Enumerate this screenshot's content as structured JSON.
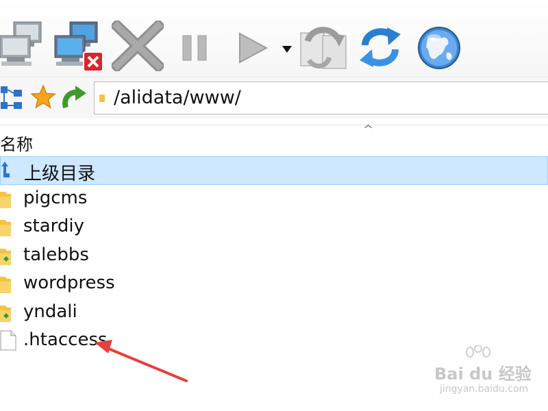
{
  "toolbar": {
    "buttons": [
      {
        "name": "connect",
        "icon": "computers-connect-icon"
      },
      {
        "name": "disconnect",
        "icon": "computers-disconnect-icon"
      },
      {
        "name": "cancel",
        "icon": "close-x-icon"
      },
      {
        "name": "pause",
        "icon": "pause-icon"
      },
      {
        "name": "play",
        "icon": "play-icon"
      },
      {
        "name": "play-menu",
        "icon": "dropdown-triangle-icon"
      },
      {
        "name": "sync",
        "icon": "sync-arrows-icon"
      },
      {
        "name": "refresh",
        "icon": "refresh-arrows-icon"
      },
      {
        "name": "web",
        "icon": "globe-icon"
      }
    ]
  },
  "address_bar": {
    "path": "/alidata/www/"
  },
  "columns": {
    "name_header": "名称"
  },
  "files": [
    {
      "label": "上级目录",
      "type": "parent",
      "selected": true
    },
    {
      "label": "pigcms",
      "type": "folder"
    },
    {
      "label": "stardiy",
      "type": "folder"
    },
    {
      "label": "talebbs",
      "type": "folder-linked"
    },
    {
      "label": "wordpress",
      "type": "folder"
    },
    {
      "label": "yndali",
      "type": "folder-linked"
    },
    {
      "label": ".htaccess",
      "type": "file"
    }
  ],
  "watermark": {
    "brand": "Bai du 经验",
    "url": "jingyan.baidu.com"
  },
  "colors": {
    "selection_fill": "#cde8ff",
    "selection_border": "#99d1ff",
    "folder": "#f5c342",
    "annotation_arrow": "#e8403a"
  }
}
